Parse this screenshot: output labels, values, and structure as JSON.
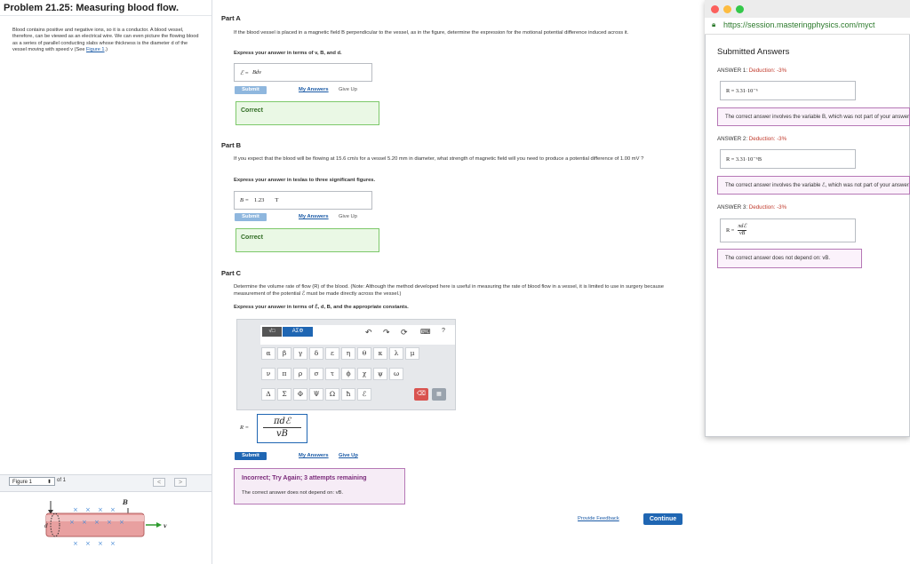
{
  "problem": {
    "title": "Problem 21.25: Measuring blood flow.",
    "description": "Blood contains positive and negative ions, so it is a conductor. A blood vessel, therefore, can be viewed as an electrical wire. We can even picture the flowing blood as a series of parallel conducting slabs whose thickness is the diameter d of the vessel moving with speed v (See ",
    "figure_link": "Figure 1",
    "description_end": ".)"
  },
  "figure_nav": {
    "select": "Figure 1",
    "of": "of 1",
    "prev": "<",
    "next": ">",
    "label_B": "B",
    "label_d": "d",
    "label_v": "v",
    "x_mark": "×"
  },
  "partA": {
    "title": "Part A",
    "question": "If the blood vessel is placed in a magnetic field B perpendicular to the vessel, as in the figure, determine the expression for the motional potential difference induced across it.",
    "express": "Express your answer in terms of v, B, and d.",
    "answer_label": "ℰ =",
    "answer_value": "Bdv",
    "submit": "Submit",
    "my_answers": "My Answers",
    "give_up": "Give Up",
    "result": "Correct"
  },
  "partB": {
    "title": "Part B",
    "question": "If you expect that the blood will be flowing at 15.6 cm/s for a vessel 5.20 mm in diameter, what strength of magnetic field will you need to produce a potential difference of 1.00 mV ?",
    "express": "Express your answer in teslas to three significant figures.",
    "answer_label": "B =",
    "answer_value": "1.23",
    "answer_unit": "T",
    "submit": "Submit",
    "my_answers": "My Answers",
    "give_up": "Give Up",
    "result": "Correct"
  },
  "partC": {
    "title": "Part C",
    "question": "Determine the volume rate of flow (R) of the blood. (Note: Although the method developed here is useful in measuring the rate of blood flow in a vessel, it is limited to use in surgery because measurement of the potential ℰ must be made directly across the vessel.)",
    "express": "Express your answer in terms of ℰ, d, B, and the appropriate constants.",
    "palette": {
      "templates_tab": "√□",
      "greek_tab": "ΑΣΦ",
      "row1": [
        "α",
        "β",
        "γ",
        "δ",
        "ε",
        "η",
        "θ",
        "κ",
        "λ",
        "μ"
      ],
      "row2": [
        "ν",
        "π",
        "ρ",
        "σ",
        "τ",
        "ϕ",
        "χ",
        "ψ",
        "ω"
      ],
      "row3": [
        "Δ",
        "Σ",
        "Φ",
        "Ψ",
        "Ω",
        "ħ",
        "ℰ"
      ],
      "undo": "↶",
      "redo": "↷",
      "reset": "⟳",
      "keyboard": "⌨",
      "help": "?"
    },
    "answer_label": "R =",
    "formula_num": "πdℰ",
    "formula_den": "vB",
    "submit": "Submit",
    "my_answers": "My Answers",
    "give_up": "Give Up",
    "result_title": "Incorrect; Try Again; 3 attempts remaining",
    "result_msg": "The correct answer does not depend on: vB."
  },
  "footer": {
    "feedback": "Provide Feedback",
    "continue": "Continue"
  },
  "popup": {
    "url": "https://session.masteringphysics.com/myct",
    "title": "Submitted Answers",
    "answers": [
      {
        "label": "ANSWER 1:",
        "deduction": "Deduction: -3%",
        "value": "R =  3.31·10⁻⁶",
        "msg": "The correct answer involves the variable B, which was not part of your answer."
      },
      {
        "label": "ANSWER 2:",
        "deduction": "Deduction: -3%",
        "value": "R =  3.31·10⁻⁶B",
        "msg": "The correct answer involves the variable ℰ, which was not part of your answer."
      },
      {
        "label": "ANSWER 3:",
        "deduction": "Deduction: -3%",
        "value_num": "πdℰ",
        "value_den": "vB",
        "value_label": "R =",
        "msg": "The correct answer does not depend on: vB."
      }
    ]
  },
  "colors": {
    "accent": "#1f66b3",
    "correct_bg": "#eaf8e5",
    "incorrect_border": "#b678b6",
    "url_green": "#2c7a2c"
  }
}
